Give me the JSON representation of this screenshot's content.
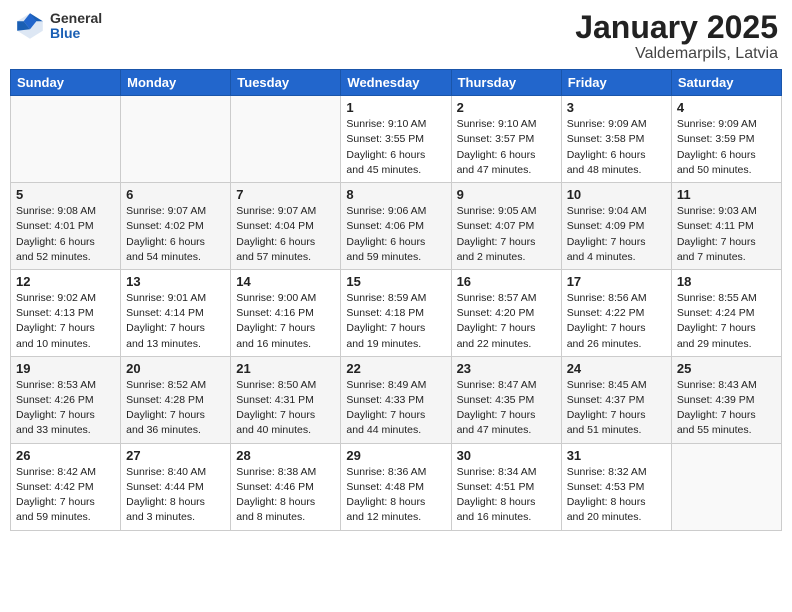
{
  "header": {
    "logo_general": "General",
    "logo_blue": "Blue",
    "title": "January 2025",
    "subtitle": "Valdemarpils, Latvia"
  },
  "weekdays": [
    "Sunday",
    "Monday",
    "Tuesday",
    "Wednesday",
    "Thursday",
    "Friday",
    "Saturday"
  ],
  "weeks": [
    [
      {
        "day": "",
        "sunrise": "",
        "sunset": "",
        "daylight": ""
      },
      {
        "day": "",
        "sunrise": "",
        "sunset": "",
        "daylight": ""
      },
      {
        "day": "",
        "sunrise": "",
        "sunset": "",
        "daylight": ""
      },
      {
        "day": "1",
        "sunrise": "Sunrise: 9:10 AM",
        "sunset": "Sunset: 3:55 PM",
        "daylight": "Daylight: 6 hours and 45 minutes."
      },
      {
        "day": "2",
        "sunrise": "Sunrise: 9:10 AM",
        "sunset": "Sunset: 3:57 PM",
        "daylight": "Daylight: 6 hours and 47 minutes."
      },
      {
        "day": "3",
        "sunrise": "Sunrise: 9:09 AM",
        "sunset": "Sunset: 3:58 PM",
        "daylight": "Daylight: 6 hours and 48 minutes."
      },
      {
        "day": "4",
        "sunrise": "Sunrise: 9:09 AM",
        "sunset": "Sunset: 3:59 PM",
        "daylight": "Daylight: 6 hours and 50 minutes."
      }
    ],
    [
      {
        "day": "5",
        "sunrise": "Sunrise: 9:08 AM",
        "sunset": "Sunset: 4:01 PM",
        "daylight": "Daylight: 6 hours and 52 minutes."
      },
      {
        "day": "6",
        "sunrise": "Sunrise: 9:07 AM",
        "sunset": "Sunset: 4:02 PM",
        "daylight": "Daylight: 6 hours and 54 minutes."
      },
      {
        "day": "7",
        "sunrise": "Sunrise: 9:07 AM",
        "sunset": "Sunset: 4:04 PM",
        "daylight": "Daylight: 6 hours and 57 minutes."
      },
      {
        "day": "8",
        "sunrise": "Sunrise: 9:06 AM",
        "sunset": "Sunset: 4:06 PM",
        "daylight": "Daylight: 6 hours and 59 minutes."
      },
      {
        "day": "9",
        "sunrise": "Sunrise: 9:05 AM",
        "sunset": "Sunset: 4:07 PM",
        "daylight": "Daylight: 7 hours and 2 minutes."
      },
      {
        "day": "10",
        "sunrise": "Sunrise: 9:04 AM",
        "sunset": "Sunset: 4:09 PM",
        "daylight": "Daylight: 7 hours and 4 minutes."
      },
      {
        "day": "11",
        "sunrise": "Sunrise: 9:03 AM",
        "sunset": "Sunset: 4:11 PM",
        "daylight": "Daylight: 7 hours and 7 minutes."
      }
    ],
    [
      {
        "day": "12",
        "sunrise": "Sunrise: 9:02 AM",
        "sunset": "Sunset: 4:13 PM",
        "daylight": "Daylight: 7 hours and 10 minutes."
      },
      {
        "day": "13",
        "sunrise": "Sunrise: 9:01 AM",
        "sunset": "Sunset: 4:14 PM",
        "daylight": "Daylight: 7 hours and 13 minutes."
      },
      {
        "day": "14",
        "sunrise": "Sunrise: 9:00 AM",
        "sunset": "Sunset: 4:16 PM",
        "daylight": "Daylight: 7 hours and 16 minutes."
      },
      {
        "day": "15",
        "sunrise": "Sunrise: 8:59 AM",
        "sunset": "Sunset: 4:18 PM",
        "daylight": "Daylight: 7 hours and 19 minutes."
      },
      {
        "day": "16",
        "sunrise": "Sunrise: 8:57 AM",
        "sunset": "Sunset: 4:20 PM",
        "daylight": "Daylight: 7 hours and 22 minutes."
      },
      {
        "day": "17",
        "sunrise": "Sunrise: 8:56 AM",
        "sunset": "Sunset: 4:22 PM",
        "daylight": "Daylight: 7 hours and 26 minutes."
      },
      {
        "day": "18",
        "sunrise": "Sunrise: 8:55 AM",
        "sunset": "Sunset: 4:24 PM",
        "daylight": "Daylight: 7 hours and 29 minutes."
      }
    ],
    [
      {
        "day": "19",
        "sunrise": "Sunrise: 8:53 AM",
        "sunset": "Sunset: 4:26 PM",
        "daylight": "Daylight: 7 hours and 33 minutes."
      },
      {
        "day": "20",
        "sunrise": "Sunrise: 8:52 AM",
        "sunset": "Sunset: 4:28 PM",
        "daylight": "Daylight: 7 hours and 36 minutes."
      },
      {
        "day": "21",
        "sunrise": "Sunrise: 8:50 AM",
        "sunset": "Sunset: 4:31 PM",
        "daylight": "Daylight: 7 hours and 40 minutes."
      },
      {
        "day": "22",
        "sunrise": "Sunrise: 8:49 AM",
        "sunset": "Sunset: 4:33 PM",
        "daylight": "Daylight: 7 hours and 44 minutes."
      },
      {
        "day": "23",
        "sunrise": "Sunrise: 8:47 AM",
        "sunset": "Sunset: 4:35 PM",
        "daylight": "Daylight: 7 hours and 47 minutes."
      },
      {
        "day": "24",
        "sunrise": "Sunrise: 8:45 AM",
        "sunset": "Sunset: 4:37 PM",
        "daylight": "Daylight: 7 hours and 51 minutes."
      },
      {
        "day": "25",
        "sunrise": "Sunrise: 8:43 AM",
        "sunset": "Sunset: 4:39 PM",
        "daylight": "Daylight: 7 hours and 55 minutes."
      }
    ],
    [
      {
        "day": "26",
        "sunrise": "Sunrise: 8:42 AM",
        "sunset": "Sunset: 4:42 PM",
        "daylight": "Daylight: 7 hours and 59 minutes."
      },
      {
        "day": "27",
        "sunrise": "Sunrise: 8:40 AM",
        "sunset": "Sunset: 4:44 PM",
        "daylight": "Daylight: 8 hours and 3 minutes."
      },
      {
        "day": "28",
        "sunrise": "Sunrise: 8:38 AM",
        "sunset": "Sunset: 4:46 PM",
        "daylight": "Daylight: 8 hours and 8 minutes."
      },
      {
        "day": "29",
        "sunrise": "Sunrise: 8:36 AM",
        "sunset": "Sunset: 4:48 PM",
        "daylight": "Daylight: 8 hours and 12 minutes."
      },
      {
        "day": "30",
        "sunrise": "Sunrise: 8:34 AM",
        "sunset": "Sunset: 4:51 PM",
        "daylight": "Daylight: 8 hours and 16 minutes."
      },
      {
        "day": "31",
        "sunrise": "Sunrise: 8:32 AM",
        "sunset": "Sunset: 4:53 PM",
        "daylight": "Daylight: 8 hours and 20 minutes."
      },
      {
        "day": "",
        "sunrise": "",
        "sunset": "",
        "daylight": ""
      }
    ]
  ]
}
